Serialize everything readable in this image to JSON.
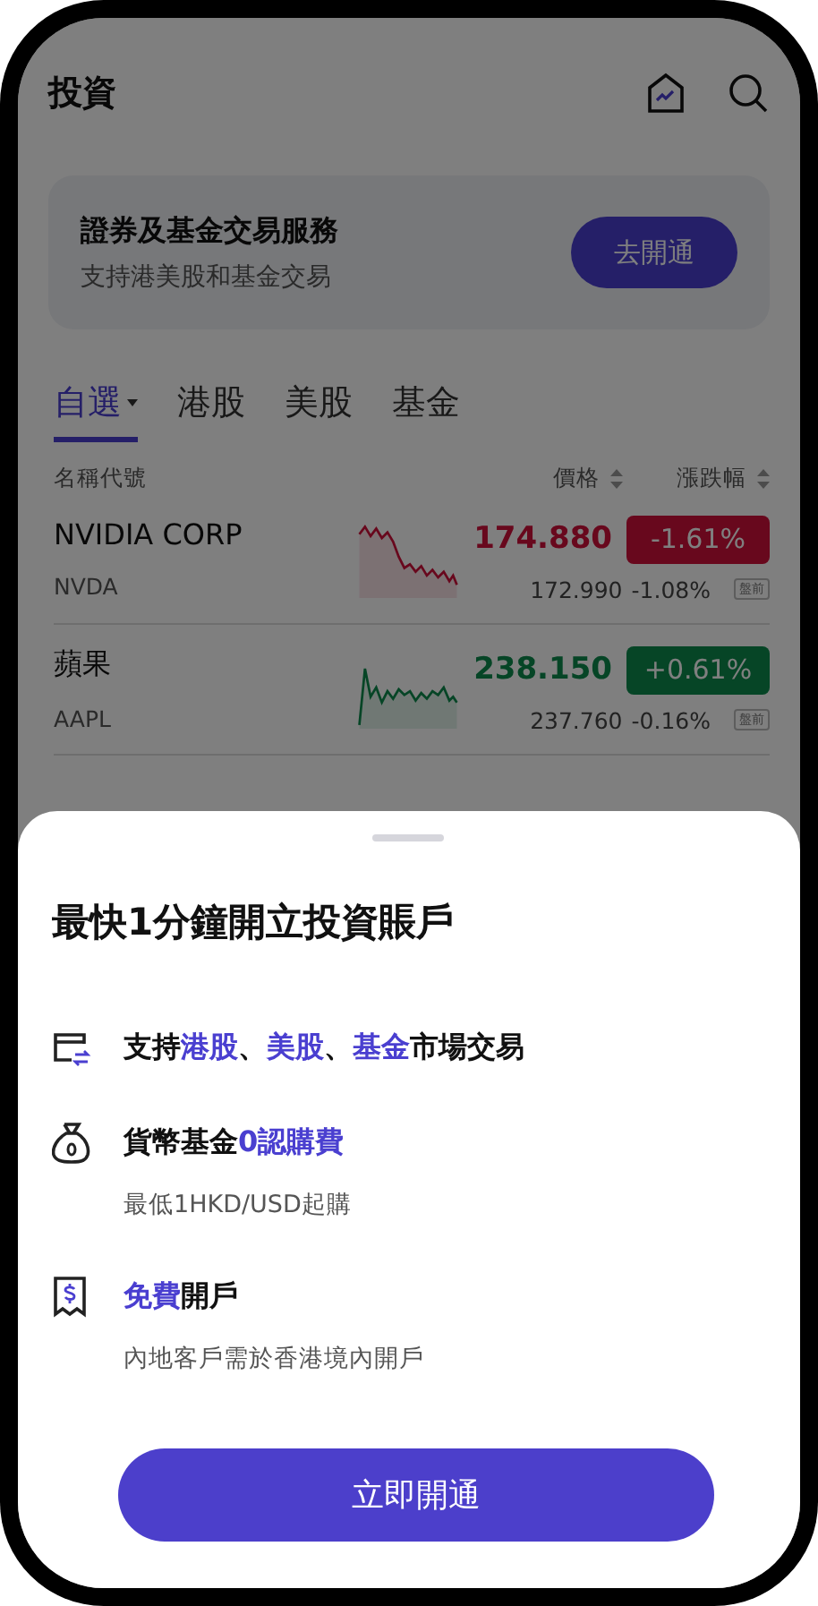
{
  "header": {
    "title": "投資"
  },
  "banner": {
    "title": "證券及基金交易服務",
    "subtitle": "支持港美股和基金交易",
    "button": "去開通"
  },
  "tabs": [
    {
      "label": "自選",
      "selected": true,
      "dropdown": true
    },
    {
      "label": "港股",
      "selected": false,
      "dropdown": false
    },
    {
      "label": "美股",
      "selected": false,
      "dropdown": false
    },
    {
      "label": "基金",
      "selected": false,
      "dropdown": false
    }
  ],
  "columns": [
    {
      "label": "名稱代號",
      "sortable": false
    },
    {
      "label": "價格",
      "sortable": true
    },
    {
      "label": "漲跌幅",
      "sortable": true
    }
  ],
  "rows": [
    {
      "name": "NVIDIA CORP",
      "code": "NVDA",
      "price": "174.880",
      "change": "-1.61%",
      "rising": false,
      "pre_price": "172.990",
      "pre_change": "-1.08%",
      "tag": "盤前"
    },
    {
      "name": "蘋果",
      "code": "AAPL",
      "price": "238.150",
      "change": "+0.61%",
      "rising": true,
      "pre_price": "237.760",
      "pre_change": "-0.16%",
      "tag": "盤前"
    }
  ],
  "overlay": {
    "dimmed": true
  },
  "sheet": {
    "title": "最快1分鐘開立投資賬戶",
    "features": [
      {
        "kind": "market",
        "parts": [
          {
            "text": "支持",
            "highlight": false
          },
          {
            "text": "港股",
            "highlight": true
          },
          {
            "text": "、",
            "highlight": false
          },
          {
            "text": "美股",
            "highlight": true
          },
          {
            "text": "、",
            "highlight": false
          },
          {
            "text": "基金",
            "highlight": true
          },
          {
            "text": "市場交易",
            "highlight": false
          }
        ]
      },
      {
        "kind": "moneybag",
        "parts": [
          {
            "text": "貨幣基金",
            "highlight": false
          },
          {
            "text": "0認購費",
            "highlight": true
          }
        ],
        "note": "最低1HKD/USD起購"
      },
      {
        "kind": "receipt",
        "parts": [
          {
            "text": "免費",
            "highlight": true
          },
          {
            "text": "開戶",
            "highlight": false
          }
        ],
        "note": "內地客戶需於香港境內開戶"
      }
    ],
    "button": "立即開通"
  }
}
